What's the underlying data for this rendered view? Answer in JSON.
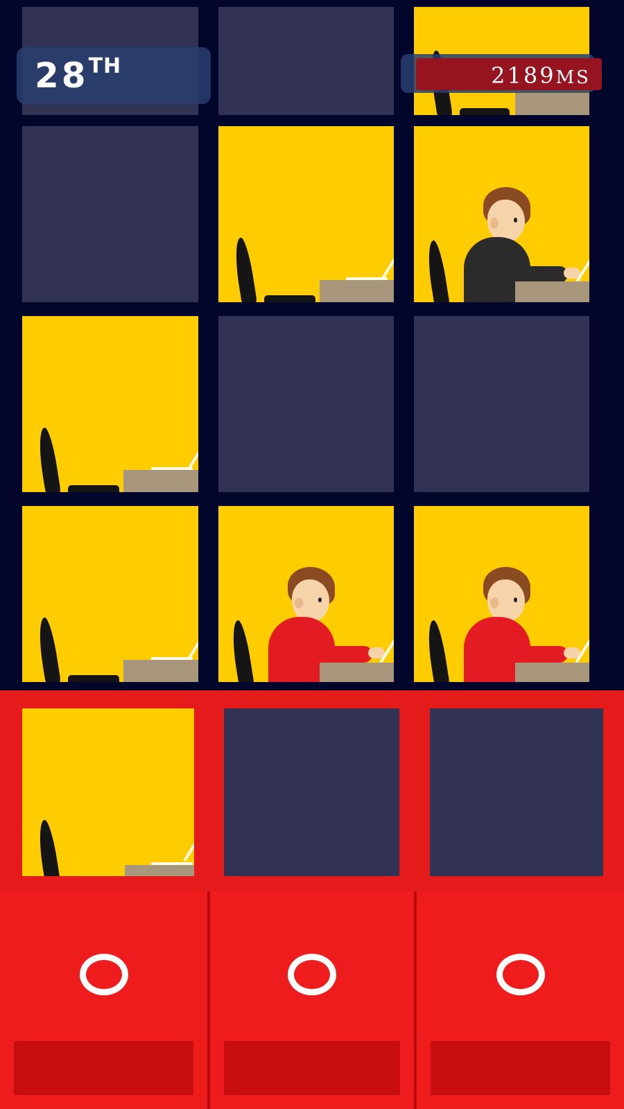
{
  "hud": {
    "rank_number": "28",
    "rank_suffix": "TH",
    "time_value": "2189",
    "time_unit": "MS"
  },
  "grid": {
    "rows": 5,
    "columns": 3,
    "lit_windows": [
      "row1-col3",
      "row2-col2",
      "row2-col3",
      "row3-col1",
      "row4-col1",
      "row4-col2",
      "row4-col3",
      "row5-col1"
    ],
    "workers": [
      {
        "window": "row2-col3",
        "shirt": "black"
      },
      {
        "window": "row4-col2",
        "shirt": "red"
      },
      {
        "window": "row4-col3",
        "shirt": "red"
      }
    ]
  },
  "controls": {
    "buttons": [
      {
        "label": "O",
        "icon": "circle-icon"
      },
      {
        "label": "O",
        "icon": "circle-icon"
      },
      {
        "label": "O",
        "icon": "circle-icon"
      }
    ]
  },
  "colors": {
    "building": "#02062a",
    "window_lit": "#ffcc00",
    "window_dark": "#323255",
    "panel_red": "#e51b1b",
    "button_tray": "#c80d10",
    "timer_bg": "#951420"
  }
}
